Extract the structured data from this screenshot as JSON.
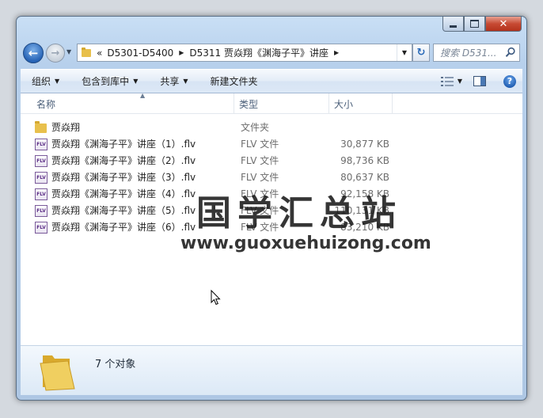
{
  "window": {
    "caption": {
      "close_glyph": "✕"
    }
  },
  "nav": {
    "back_glyph": "←",
    "forward_glyph": "→",
    "breadcrumbs": [
      {
        "label": "«"
      },
      {
        "label": "D5301-D5400"
      },
      {
        "label": "D5311 贾焱翔《渊海子平》讲座"
      }
    ],
    "search_placeholder": "搜索 D531..."
  },
  "toolbar": {
    "organize_label": "组织",
    "include_library_label": "包含到库中",
    "share_label": "共享",
    "new_folder_label": "新建文件夹",
    "help_glyph": "?"
  },
  "columns": {
    "name": "名称",
    "type": "类型",
    "size": "大小"
  },
  "files": [
    {
      "icon": "folder-icon",
      "name": "贾焱翔",
      "type": "文件夹",
      "size": ""
    },
    {
      "icon": "flv-file-icon",
      "name": "贾焱翔《渊海子平》讲座（1）.flv",
      "type": "FLV 文件",
      "size": "30,877 KB"
    },
    {
      "icon": "flv-file-icon",
      "name": "贾焱翔《渊海子平》讲座（2）.flv",
      "type": "FLV 文件",
      "size": "98,736 KB"
    },
    {
      "icon": "flv-file-icon",
      "name": "贾焱翔《渊海子平》讲座（3）.flv",
      "type": "FLV 文件",
      "size": "80,637 KB"
    },
    {
      "icon": "flv-file-icon",
      "name": "贾焱翔《渊海子平》讲座（4）.flv",
      "type": "FLV 文件",
      "size": "92,158 KB"
    },
    {
      "icon": "flv-file-icon",
      "name": "贾焱翔《渊海子平》讲座（5）.flv",
      "type": "FLV 文件",
      "size": "110,131 KB"
    },
    {
      "icon": "flv-file-icon",
      "name": "贾焱翔《渊海子平》讲座（6）.flv",
      "type": "FLV 文件",
      "size": "83,210 KB"
    }
  ],
  "flv_icon_text": "FLV",
  "watermark": {
    "title": "国学汇总站",
    "url": "www.guoxuehuizong.com"
  },
  "details": {
    "object_count": "7 个对象"
  },
  "colors": {
    "folder": "#e8c04c",
    "close_button": "#c74a33",
    "accent": "#2663b6"
  }
}
